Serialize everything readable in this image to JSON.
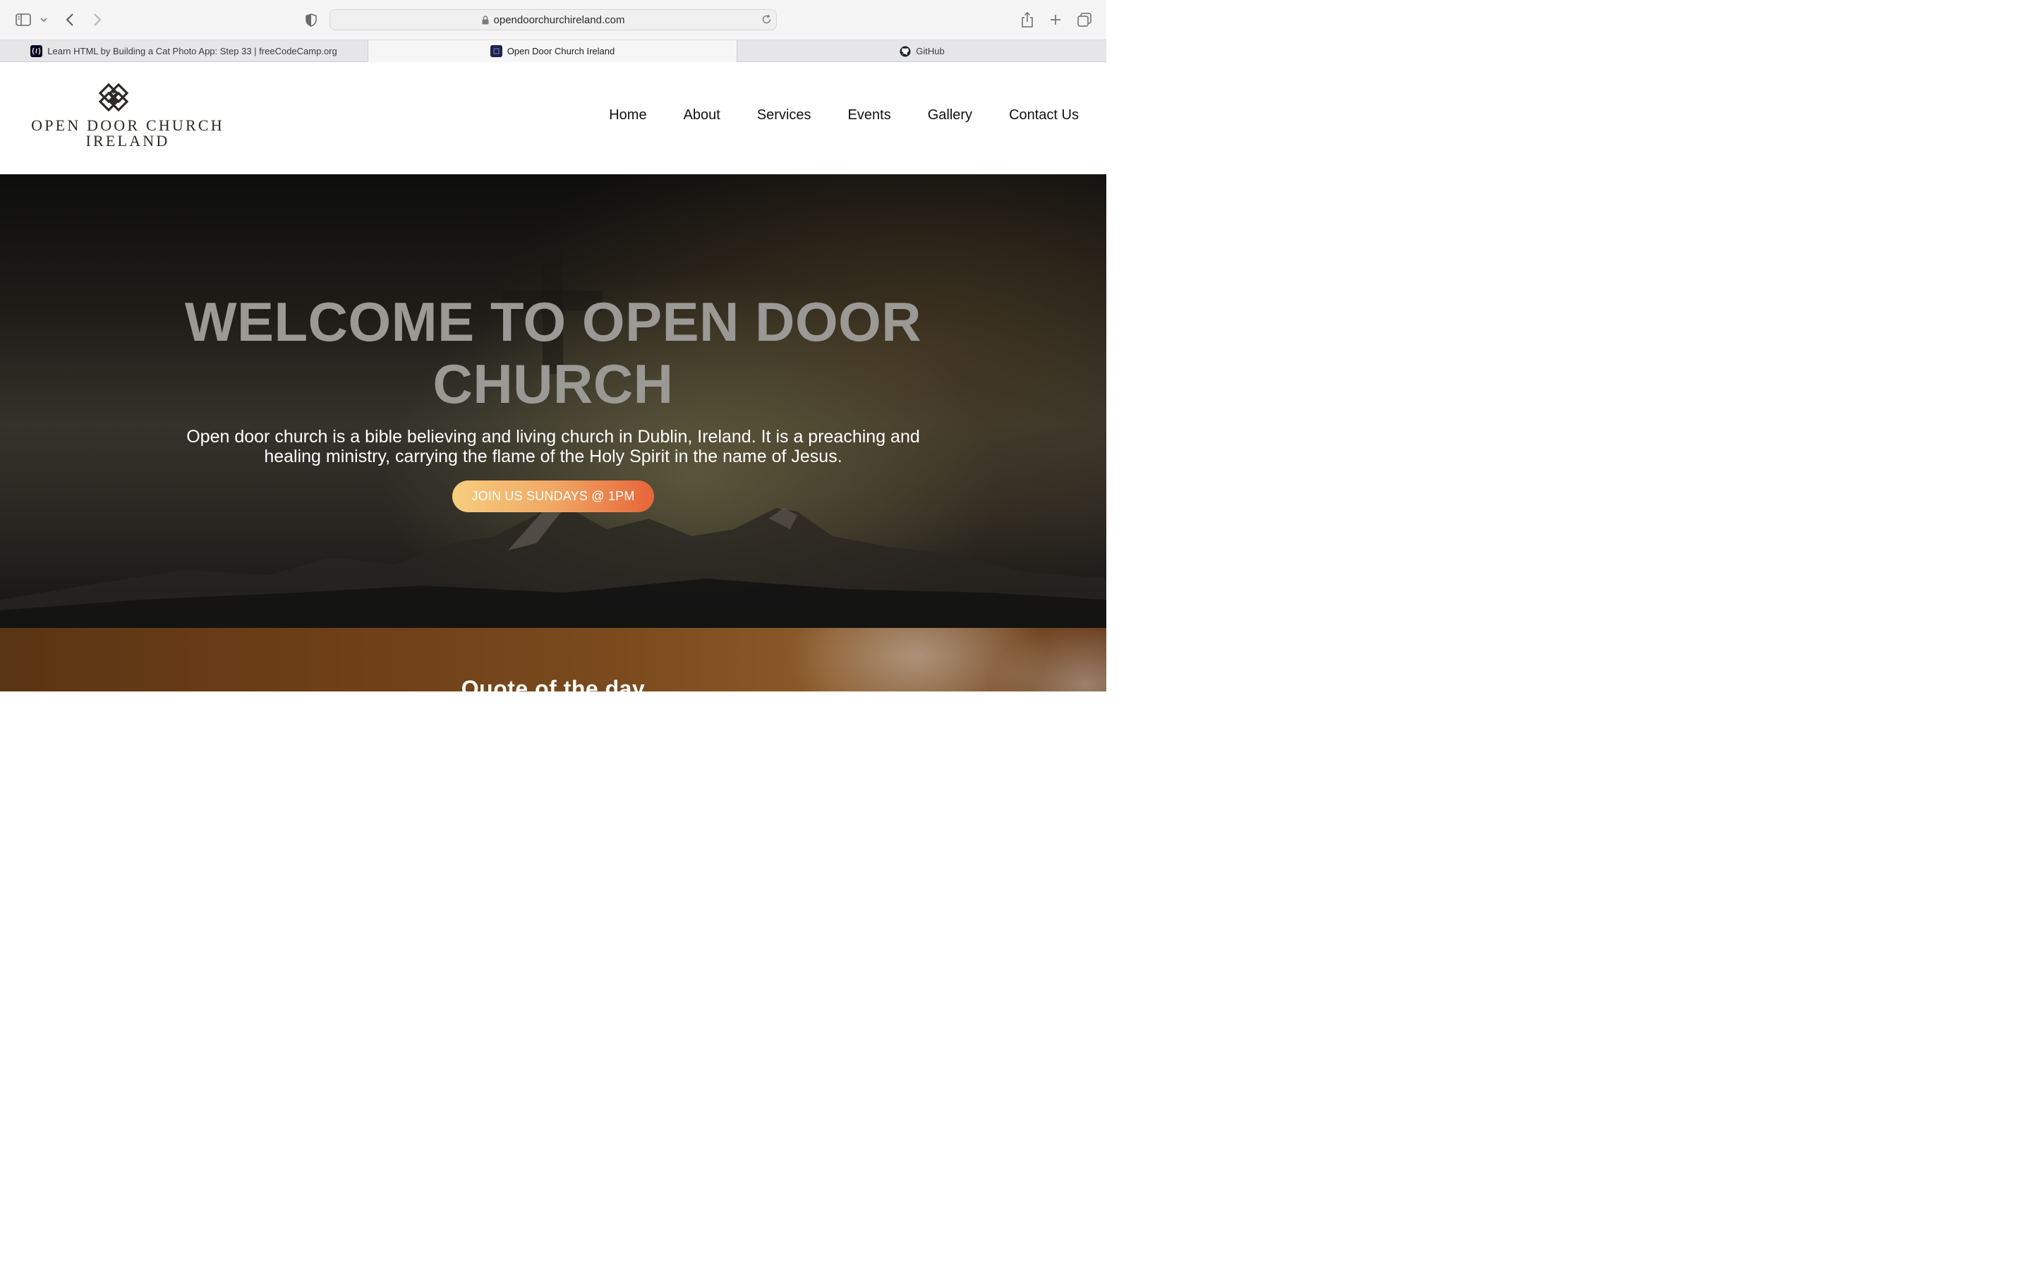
{
  "browser": {
    "url": "opendoorchurchireland.com",
    "tabs": [
      {
        "label": "Learn HTML by Building a Cat Photo App: Step 33 | freeCodeCamp.org",
        "icon": "freecodecamp-icon"
      },
      {
        "label": "Open Door Church Ireland",
        "icon": "site-favicon"
      },
      {
        "label": "GitHub",
        "icon": "github-icon"
      }
    ],
    "active_tab": 1
  },
  "site": {
    "logo_line1": "OPEN DOOR CHURCH",
    "logo_line2": "IRELAND",
    "nav": [
      "Home",
      "About",
      "Services",
      "Events",
      "Gallery",
      "Contact Us"
    ]
  },
  "hero": {
    "title_line1": "WELCOME TO OPEN DOOR",
    "title_line2": "CHURCH",
    "description": "Open door church is a bible believing and living church in Dublin, Ireland. It is a preaching and healing ministry, carrying the flame of the Holy Spirit in the name of Jesus.",
    "cta_label": "JOIN US SUNDAYS @ 1PM"
  },
  "quote": {
    "title": "Quote of the day"
  },
  "colors": {
    "cta_start": "#f7cd7f",
    "cta_end": "#e7643a",
    "hero_title": "#9a9995",
    "logo": "#2d2a26"
  }
}
